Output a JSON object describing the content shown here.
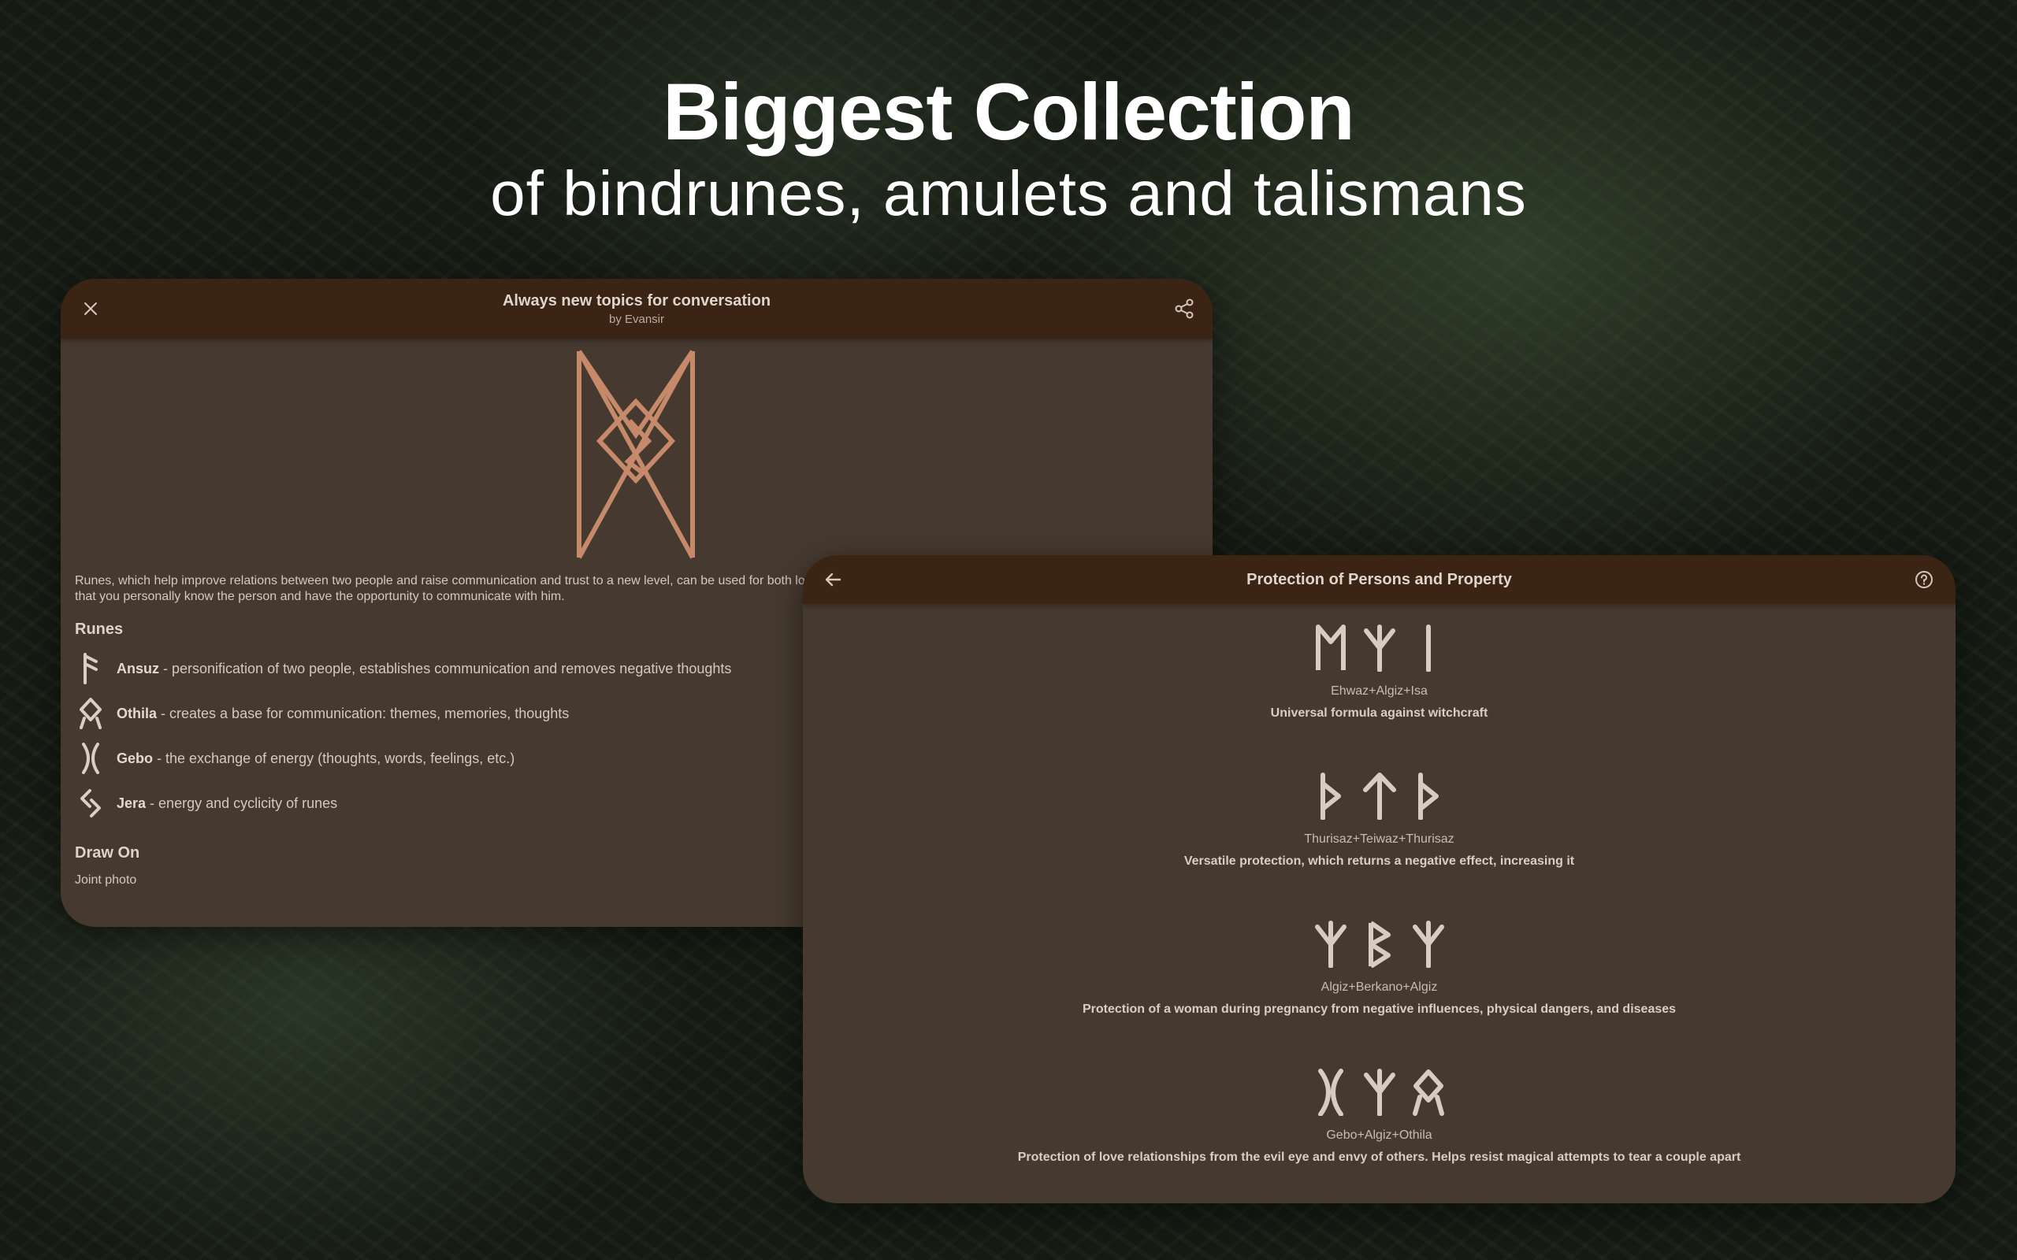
{
  "headline": {
    "title": "Biggest Collection",
    "subtitle": "of bindrunes, amulets and talismans"
  },
  "detail_screen": {
    "title": "Always new topics for conversation",
    "author": "by Evansir",
    "close_icon": "close-icon",
    "share_icon": "share-icon",
    "accent_color": "#c68a6a",
    "description_line1": "Runes,  which help improve relations between two people and raise communication and trust to a new level,  can be used for both lo",
    "description_line2": "that you personally know the person and have the opportunity to communicate with him.",
    "runes_heading": "Runes",
    "runes": [
      {
        "name": "Ansuz",
        "desc": " - personification of two people, establishes communication and removes negative thoughts"
      },
      {
        "name": "Othila",
        "desc": " - creates a base for communication: themes, memories, thoughts"
      },
      {
        "name": "Gebo",
        "desc": " - the exchange of energy (thoughts, words, feelings, etc.)"
      },
      {
        "name": "Jera",
        "desc": " - energy and cyclicity of runes"
      }
    ],
    "draw_on_heading": "Draw On",
    "draw_on_value": "Joint photo"
  },
  "list_screen": {
    "title": "Protection of Persons and Property",
    "back_icon": "arrow-left-icon",
    "help_icon": "help-circle-icon",
    "entries": [
      {
        "formula": "Ehwaz+Algiz+Isa",
        "meaning": "Universal formula against witchcraft"
      },
      {
        "formula": "Thurisaz+Teiwaz+Thurisaz",
        "meaning": "Versatile protection, which returns a negative effect, increasing it"
      },
      {
        "formula": "Algiz+Berkano+Algiz",
        "meaning": "Protection of a woman during pregnancy from negative influences, physical dangers, and diseases"
      },
      {
        "formula": "Gebo+Algiz+Othila",
        "meaning": "Protection of love relationships from the evil eye and envy of others. Helps resist magical attempts to tear a couple apart"
      }
    ]
  }
}
